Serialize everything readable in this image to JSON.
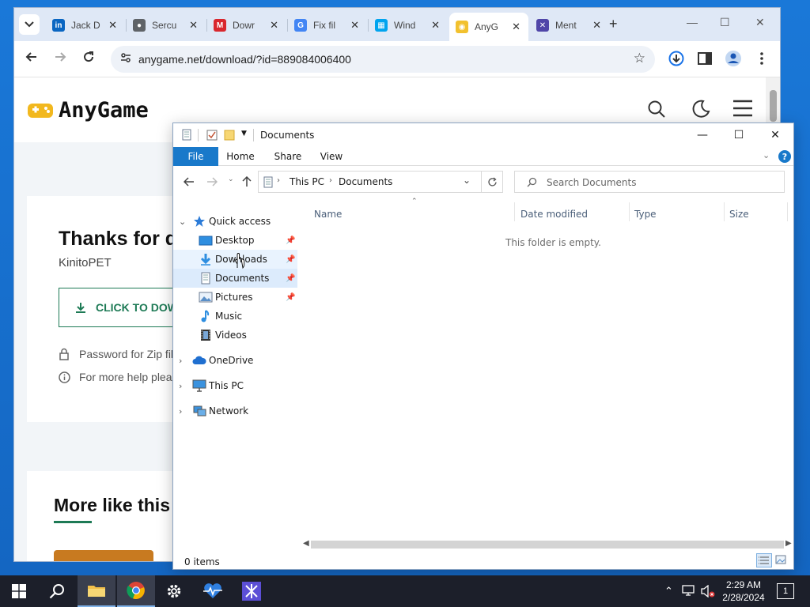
{
  "browser": {
    "tabs": [
      {
        "title": "Jack D",
        "favicon": "linkedin-icon",
        "color": "#0a66c2"
      },
      {
        "title": "Sercu",
        "favicon": "globe-icon",
        "color": "#5f6368"
      },
      {
        "title": "Dowr",
        "favicon": "mega-icon",
        "color": "#d9272e"
      },
      {
        "title": "Fix fil",
        "favicon": "google-icon",
        "color": "#4285f4"
      },
      {
        "title": "Wind",
        "favicon": "windows-icon",
        "color": "#00a4ef"
      },
      {
        "title": "AnyG",
        "favicon": "anygame-icon",
        "color": "#f2c12e"
      },
      {
        "title": "Ment",
        "favicon": "mentor-icon",
        "color": "#5046a8"
      }
    ],
    "active_tab": 5,
    "url": "anygame.net/download/?id=889084006400"
  },
  "site": {
    "logo_text": "AnyGame",
    "heading": "Thanks for d",
    "publisher": "KinitoPET",
    "download_button": "CLICK TO DOW",
    "password_note": "Password for Zip fil",
    "help_note": "For more help plea",
    "more_heading": "More like this"
  },
  "explorer": {
    "title": "Documents",
    "ribbon_tabs": [
      "File",
      "Home",
      "Share",
      "View"
    ],
    "breadcrumb": [
      "This PC",
      "Documents"
    ],
    "search_placeholder": "Search Documents",
    "nav": {
      "quick_access": "Quick access",
      "quick_items": [
        {
          "label": "Desktop",
          "icon": "desktop-icon",
          "pinned": true
        },
        {
          "label": "Downloads",
          "icon": "downloads-icon",
          "pinned": true
        },
        {
          "label": "Documents",
          "icon": "documents-icon",
          "pinned": true
        },
        {
          "label": "Pictures",
          "icon": "pictures-icon",
          "pinned": true
        },
        {
          "label": "Music",
          "icon": "music-icon",
          "pinned": false
        },
        {
          "label": "Videos",
          "icon": "videos-icon",
          "pinned": false
        }
      ],
      "onedrive": "OneDrive",
      "this_pc": "This PC",
      "network": "Network"
    },
    "columns": [
      "Name",
      "Date modified",
      "Type",
      "Size"
    ],
    "empty_message": "This folder is empty.",
    "status": "0 items"
  },
  "taskbar": {
    "time": "2:29 AM",
    "date": "2/28/2024",
    "notification_count": "1"
  }
}
